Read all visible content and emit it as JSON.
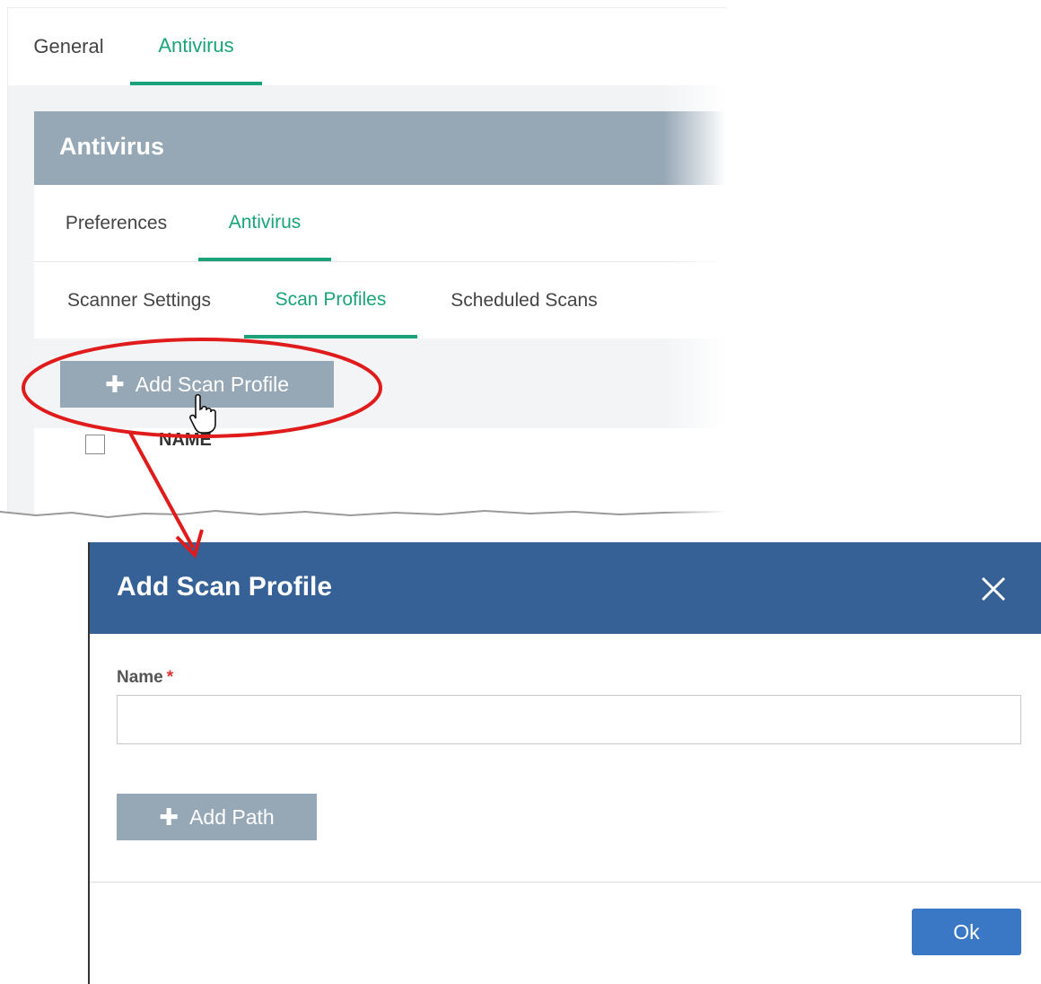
{
  "tabs": [
    {
      "label": "General",
      "active": false
    },
    {
      "label": "Antivirus",
      "active": true
    }
  ],
  "section": {
    "title": "Antivirus"
  },
  "subtabs": [
    {
      "label": "Preferences",
      "active": false
    },
    {
      "label": "Antivirus",
      "active": true
    }
  ],
  "inner_tabs": [
    {
      "label": "Scanner Settings",
      "active": false
    },
    {
      "label": "Scan Profiles",
      "active": true
    },
    {
      "label": "Scheduled Scans",
      "active": false
    }
  ],
  "toolbar": {
    "add_profile_label": "Add Scan Profile"
  },
  "table": {
    "columns": [
      "NAME"
    ]
  },
  "modal": {
    "title": "Add Scan Profile",
    "name_label": "Name",
    "required_marker": "*",
    "name_value": "",
    "add_path_label": "Add Path",
    "ok_label": "Ok"
  },
  "icons": {
    "plus": "plus-icon",
    "close": "close-icon",
    "cursor": "hand-cursor-icon"
  },
  "colors": {
    "accent_green": "#1aa37a",
    "header_gray": "#96a7b5",
    "modal_blue": "#356196",
    "ok_blue": "#3a78c5",
    "annotation_red": "#e01b1b"
  }
}
